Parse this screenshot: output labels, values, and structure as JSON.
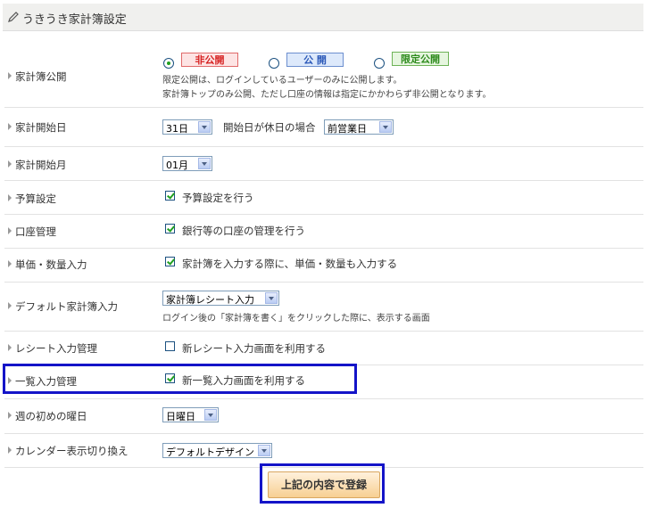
{
  "header": {
    "title": "うきうき家計簿設定"
  },
  "rows": {
    "publish": {
      "label": "家計簿公開",
      "options": [
        {
          "badge": "非公開",
          "selected": true
        },
        {
          "badge": "公 開",
          "selected": false
        },
        {
          "badge": "限定公開",
          "selected": false
        }
      ],
      "note1": "限定公開は、ログインしているユーザーのみに公開します。",
      "note2": "家計簿トップのみ公開、ただし口座の情報は指定にかかわらず非公開となります。"
    },
    "start_day": {
      "label": "家計開始日",
      "value": "31日",
      "holiday_label": "開始日が休日の場合",
      "holiday_value": "前営業日"
    },
    "start_month": {
      "label": "家計開始月",
      "value": "01月"
    },
    "budget": {
      "label": "予算設定",
      "text": "予算設定を行う",
      "checked": true
    },
    "account": {
      "label": "口座管理",
      "text": "銀行等の口座の管理を行う",
      "checked": true
    },
    "unit_price": {
      "label": "単価・数量入力",
      "text": "家計簿を入力する際に、単価・数量も入力する",
      "checked": true
    },
    "default_input": {
      "label": "デフォルト家計簿入力",
      "value": "家計簿レシート入力",
      "note": "ログイン後の「家計簿を書く」をクリックした際に、表示する画面"
    },
    "receipt": {
      "label": "レシート入力管理",
      "text": "新レシート入力画面を利用する",
      "checked": false
    },
    "list_input": {
      "label": "一覧入力管理",
      "text": "新一覧入力画面を利用する",
      "checked": true
    },
    "week_start": {
      "label": "週の初めの曜日",
      "value": "日曜日"
    },
    "calendar": {
      "label": "カレンダー表示切り換え",
      "value": "デフォルトデザイン"
    }
  },
  "submit": {
    "label": "上記の内容で登録"
  },
  "colors": {
    "highlight": "#1414c8",
    "check": "#21a121"
  }
}
